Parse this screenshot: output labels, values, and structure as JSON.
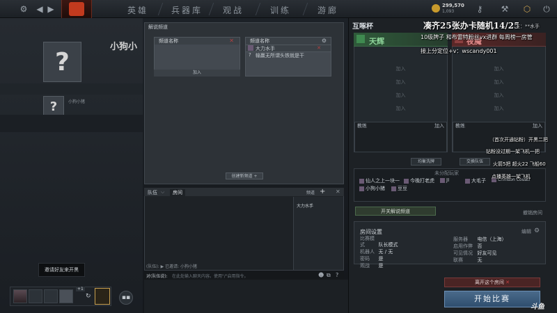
{
  "topbar": {
    "tabs": [
      "英雄",
      "兵器库",
      "观战",
      "训练",
      "游廊"
    ],
    "gold": "299,570",
    "shards": "1,093"
  },
  "left": {
    "username": "小狗小",
    "username_small": "小狗小猪",
    "invite_tip": "邀请好友来开黑",
    "party_count": "+1"
  },
  "center": {
    "title": "解说频道",
    "left_header": "频道名称",
    "right_header": "频道名称",
    "right_rows": [
      "大力水手",
      "输赢无所谓头铁就是干"
    ],
    "join": "加入",
    "new_channel": "创建新频道"
  },
  "chat": {
    "tab_team": "队伍",
    "tab_room": "房间",
    "members_header": "频道",
    "members": [
      "大力水手"
    ],
    "status_line": "(队伍): ▶ 已邀请: 小狗小猪",
    "input_prefix": "对(队伍说):",
    "input_placeholder": "在此处输入聊天内容。使用\"/\"启用指令。"
  },
  "room": {
    "title": "互啄杯",
    "radiant": "天辉",
    "dire": "夜魇",
    "join_label": "加入",
    "coach_label": "教练",
    "swap_radiant": "均衡洗牌",
    "swap_teams": "交换队伍",
    "unassigned_label": "未分配玩家",
    "unassigned_players": [
      "仙人之上一块一",
      "今晚打老虎",
      "JI",
      "大毛子",
      "Crimson Couatl",
      "小狗小猪",
      "豆豆"
    ],
    "open_caster": "开关解说频道",
    "unlock_room": "撤销房间",
    "settings_title": "房间设置",
    "settings_edit": "编辑",
    "settings": {
      "left": [
        [
          "比赛模式",
          "队长模式"
        ],
        [
          "机器人",
          "无 / 无"
        ],
        [
          "密码",
          "是"
        ],
        [
          "观战",
          "是"
        ]
      ],
      "right": [
        [
          "服务器",
          "电信（上海）"
        ],
        [
          "启用作弊",
          "否"
        ],
        [
          "可见情况",
          "好友可见"
        ],
        [
          "联赛",
          "无"
        ]
      ]
    },
    "leave_room": "离开这个房间",
    "start_game": "开始比赛"
  },
  "overlay": {
    "headline": "凑齐25张办卡随机14/25",
    "line1": "10级牌子 和布雷特粉丝vx进群  每周榜一房管",
    "host_tag": "主：**水手",
    "line2": "接上分定位+v：wscandy001",
    "side": [
      "（首次开通钻粉）开黑二把",
      "钻粉没过期一架飞机一把",
      "火箭5把  超火22  飞船60",
      "点播英雄一架飞机"
    ],
    "watermark": "斗鱼"
  }
}
